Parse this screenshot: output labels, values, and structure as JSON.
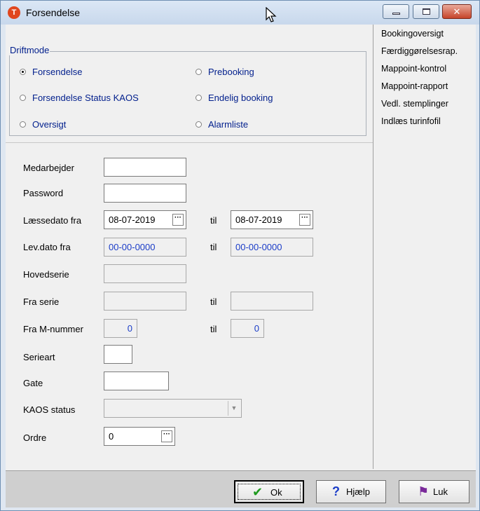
{
  "window": {
    "title": "Forsendelse",
    "app_icon_glyph": "T",
    "controls": {
      "minimize": "minimize-icon",
      "maximize": "maximize-icon",
      "close": "close-icon",
      "close_glyph": "✕"
    }
  },
  "sidebar": {
    "items": [
      {
        "label": "Bookingoversigt"
      },
      {
        "label": "Færdiggørelsesrap."
      },
      {
        "label": "Mappoint-kontrol"
      },
      {
        "label": "Mappoint-rapport"
      },
      {
        "label": "Vedl. stemplinger"
      },
      {
        "label": "Indlæs turinfofil"
      }
    ]
  },
  "driftmode": {
    "legend": "Driftmode",
    "options": [
      {
        "label": "Forsendelse",
        "selected": true
      },
      {
        "label": "Prebooking",
        "selected": false
      },
      {
        "label": "Forsendelse Status KAOS",
        "selected": false
      },
      {
        "label": "Endelig booking",
        "selected": false
      },
      {
        "label": "Oversigt",
        "selected": false
      },
      {
        "label": "Alarmliste",
        "selected": false
      }
    ]
  },
  "form": {
    "til_label": "til",
    "medarbejder": {
      "label": "Medarbejder",
      "value": ""
    },
    "password": {
      "label": "Password",
      "value": ""
    },
    "laessedato": {
      "label": "Læssedato fra",
      "from": "08-07-2019",
      "to": "08-07-2019"
    },
    "levdato": {
      "label": "Lev.dato fra",
      "from": "00-00-0000",
      "to": "00-00-0000"
    },
    "hovedserie": {
      "label": "Hovedserie",
      "value": ""
    },
    "fraserie": {
      "label": "Fra serie",
      "from": "",
      "to": ""
    },
    "mnummer": {
      "label": "Fra M-nummer",
      "from": "0",
      "to": "0"
    },
    "serieart": {
      "label": "Serieart",
      "value": ""
    },
    "gate": {
      "label": "Gate",
      "value": ""
    },
    "kaos": {
      "label": "KAOS status",
      "value": ""
    },
    "ordre": {
      "label": "Ordre",
      "value": "0"
    },
    "ellipsis": "···",
    "dropdown_glyph": "▼"
  },
  "buttons": {
    "ok": {
      "label": "Ok",
      "icon": "checkmark-icon",
      "icon_glyph": "✔",
      "color": "#1f9a1f"
    },
    "help": {
      "label": "Hjælp",
      "icon": "question-icon",
      "icon_glyph": "?",
      "color": "#1a3cc8"
    },
    "close": {
      "label": "Luk",
      "icon": "door-exit-icon",
      "icon_glyph": "⚑",
      "color": "#7a2a9a"
    }
  },
  "colors": {
    "accent_text": "#001e8c",
    "value_blue": "#1a3cc8",
    "titlebar": "#c8d8ec",
    "close_button": "#c6442a"
  }
}
